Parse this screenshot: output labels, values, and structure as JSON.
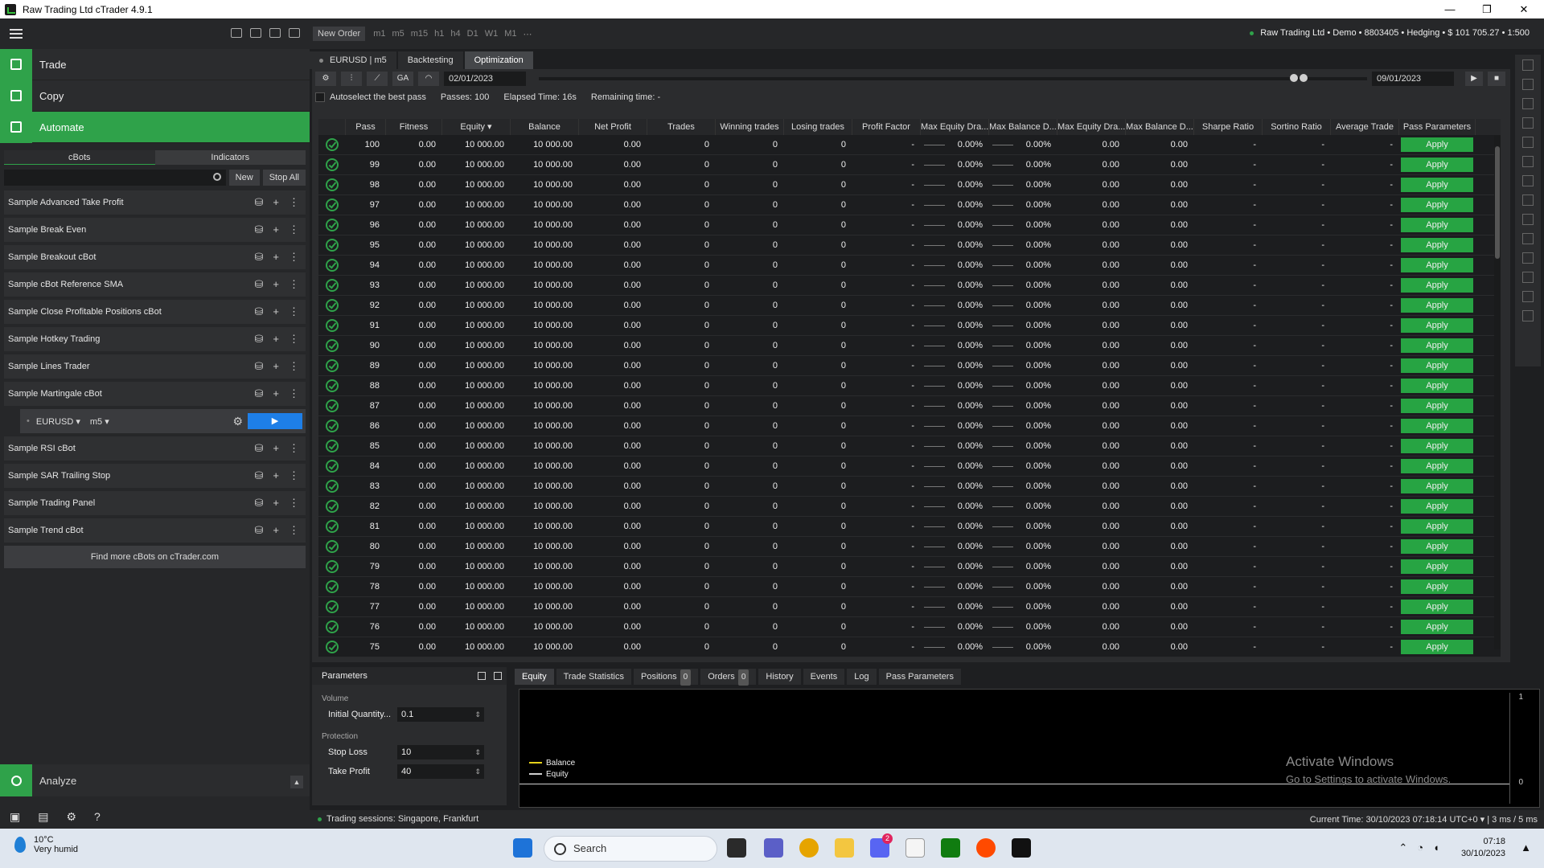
{
  "window": {
    "title": "Raw Trading Ltd cTrader 4.9.1",
    "controls": [
      "—",
      "❐",
      "✕"
    ]
  },
  "nav": {
    "trade": "Trade",
    "copy": "Copy",
    "automate": "Automate",
    "analyze": "Analyze"
  },
  "automate_panel": {
    "tabs": [
      "cBots",
      "Indicators"
    ],
    "new_label": "New",
    "stop_all_label": "Stop All",
    "bots": [
      "Sample Advanced Take Profit",
      "Sample Break Even",
      "Sample Breakout cBot",
      "Sample cBot Reference SMA",
      "Sample Close Profitable Positions cBot",
      "Sample Hotkey Trading",
      "Sample Lines Trader",
      "Sample Martingale cBot",
      "Sample RSI cBot",
      "Sample SAR Trailing Stop",
      "Sample Trading Panel",
      "Sample Trend cBot"
    ],
    "instance": {
      "symbol": "EURUSD ▾",
      "timeframe": "m5 ▾",
      "play": "▶"
    },
    "find_more": "Find more cBots on cTrader.com"
  },
  "toolbar": {
    "new_order": "New Order",
    "timeframes": [
      "m1",
      "m5",
      "m15",
      "h1",
      "h4",
      "D1",
      "W1",
      "M1",
      "⋯"
    ],
    "account": "Raw Trading Ltd • Demo • 8803405 • Hedging • $ 101 705.27 • 1:500"
  },
  "chart_tabs": {
    "symbol": "EURUSD",
    "timeframe": "m5",
    "backtesting": "Backtesting",
    "optimization": "Optimization"
  },
  "optimization": {
    "ga_label": "GA",
    "start_date": "02/01/2023",
    "end_date": "09/01/2023",
    "progress": 1.0,
    "autoselect": "Autoselect the best pass",
    "passes": "Passes:  100",
    "elapsed": "Elapsed Time:  16s",
    "remaining": "Remaining time:  -",
    "columns": [
      "Pass",
      "Fitness",
      "Equity ▾",
      "Balance",
      "Net Profit",
      "Trades",
      "Winning trades",
      "Losing trades",
      "Profit Factor",
      "Max Equity Dra...",
      "Max Balance D...",
      "Max Equity Dra...",
      "Max Balance D...",
      "Sharpe Ratio",
      "Sortino Ratio",
      "Average Trade",
      "Pass Parameters"
    ],
    "row_values": {
      "fitness": "0.00",
      "equity": "10 000.00",
      "balance": "10 000.00",
      "net_profit": "0.00",
      "trades": "0",
      "winning": "0",
      "losing": "0",
      "profit_factor": "-",
      "dd_pct": "0.00%",
      "dd_abs": "0.00",
      "sharpe": "-",
      "sortino": "-",
      "avg_trade": "-",
      "apply": "Apply"
    },
    "passes_list": [
      100,
      99,
      98,
      97,
      96,
      95,
      94,
      93,
      92,
      91,
      90,
      89,
      88,
      87,
      86,
      85,
      84,
      83,
      82,
      81,
      80,
      79,
      78,
      77,
      76,
      75
    ]
  },
  "parameters": {
    "title": "Parameters",
    "groups": [
      {
        "name": "Volume",
        "items": [
          {
            "label": "Initial Quantity...",
            "value": "0.1"
          }
        ]
      },
      {
        "name": "Protection",
        "items": [
          {
            "label": "Stop Loss",
            "value": "10"
          },
          {
            "label": "Take Profit",
            "value": "40"
          }
        ]
      }
    ]
  },
  "bottom_tabs": [
    {
      "label": "Equity"
    },
    {
      "label": "Trade Statistics"
    },
    {
      "label": "Positions",
      "badge": "0"
    },
    {
      "label": "Orders",
      "badge": "0"
    },
    {
      "label": "History"
    },
    {
      "label": "Events"
    },
    {
      "label": "Log"
    },
    {
      "label": "Pass Parameters"
    }
  ],
  "equity_chart": {
    "tick_top": "1",
    "tick_bottom": "0",
    "legend": [
      "Balance",
      "Equity"
    ],
    "legend_colors": [
      "#e6d21a",
      "#cfcfcf"
    ]
  },
  "watermark": {
    "line1": "Activate Windows",
    "line2": "Go to Settings to activate Windows."
  },
  "statusbar": {
    "sessions": "Trading sessions: Singapore, Frankfurt",
    "time": "Current Time: 30/10/2023 07:18:14  UTC+0  ▾  |  3 ms / 5 ms"
  },
  "taskbar": {
    "temp": "10°C",
    "weather": "Very humid",
    "search": "Search",
    "time": "07:18",
    "date": "30/10/2023",
    "discord_badge": "2"
  }
}
